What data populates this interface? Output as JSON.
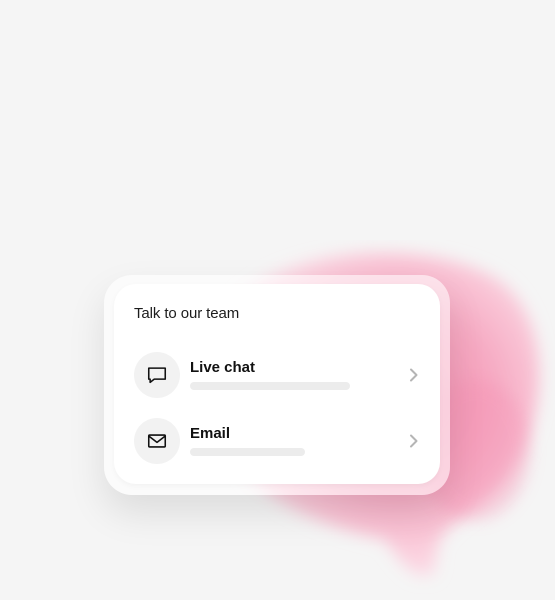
{
  "card": {
    "title": "Talk to our team"
  },
  "options": [
    {
      "label": "Live chat",
      "icon": "chat-bubble-icon"
    },
    {
      "label": "Email",
      "icon": "mail-icon"
    }
  ],
  "colors": {
    "background": "#f5f5f5",
    "card": "#ffffff",
    "accent_pink": "#f7a9bf",
    "icon_bg": "#f2f2f2",
    "skeleton": "#ececec",
    "chevron": "#b5b5b5"
  }
}
